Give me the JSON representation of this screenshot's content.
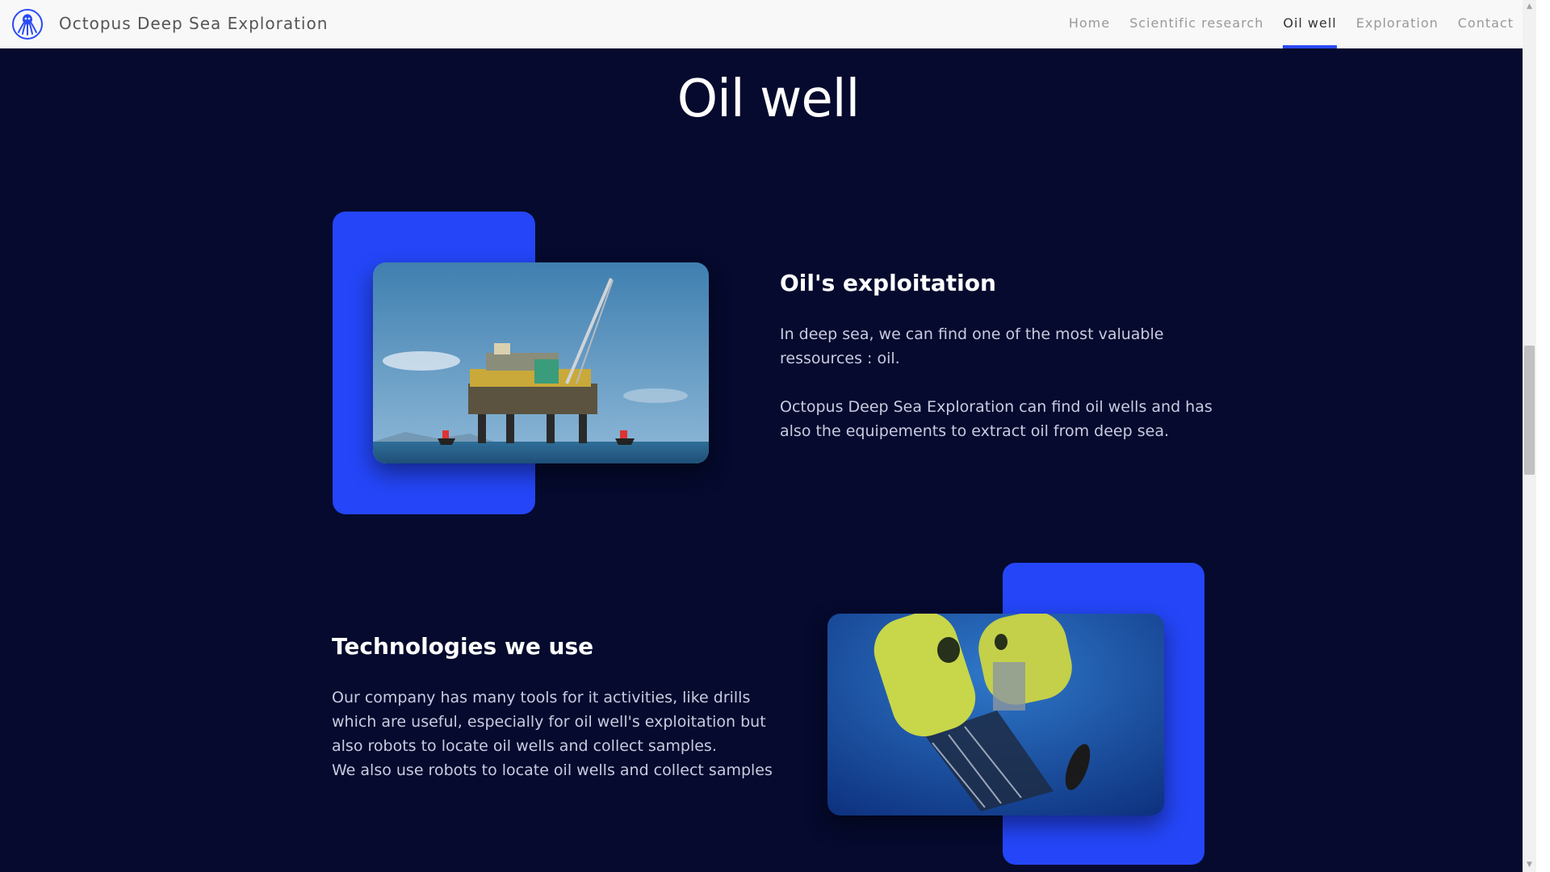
{
  "navbar": {
    "brand": "Octopus Deep Sea Exploration",
    "logo_icon": "octopus-logo-icon",
    "links": [
      {
        "label": "Home",
        "active": false
      },
      {
        "label": "Scientific research",
        "active": false
      },
      {
        "label": "Oil well",
        "active": true
      },
      {
        "label": "Exploration",
        "active": false
      },
      {
        "label": "Contact",
        "active": false
      }
    ]
  },
  "page": {
    "title": "Oil well"
  },
  "sections": [
    {
      "title": "Oil's exploitation",
      "paragraphs": [
        [
          "In deep sea, we can find one of the most valuable",
          "ressources : oil."
        ],
        [
          "Octopus Deep Sea Exploration can find oil wells and has",
          "also the equipements to extract oil from deep sea."
        ]
      ],
      "image": "oil-platform-photo"
    },
    {
      "title": "Technologies we use",
      "paragraphs": [
        [
          "Our company has many tools for it activities, like drills",
          "which are useful, especially for oil well's exploitation but",
          "also robots to locate oil wells and collect samples.",
          "We also use robots to locate oil wells and collect samples"
        ]
      ],
      "image": "underwater-robot-photo"
    }
  ],
  "colors": {
    "background": "#050a2e",
    "accent": "#2446f8",
    "navbar": "#f8f8f8"
  }
}
